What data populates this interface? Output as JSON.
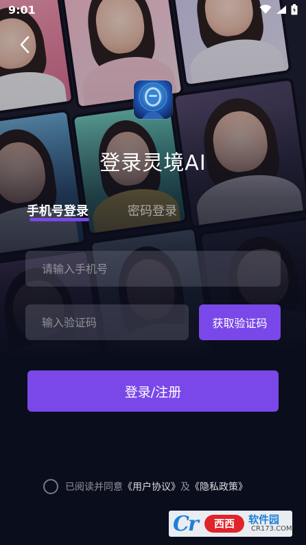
{
  "status_bar": {
    "time": "9:01",
    "icons": [
      "wifi-icon",
      "signal-icon",
      "battery-icon"
    ]
  },
  "navigation": {
    "back_icon": "chevron-left-icon"
  },
  "header": {
    "app_logo": "robot-avatar-logo",
    "title": "登录灵境AI"
  },
  "tabs": [
    {
      "label": "手机号登录",
      "active": true
    },
    {
      "label": "密码登录",
      "active": false
    }
  ],
  "form": {
    "phone_placeholder": "请输入手机号",
    "phone_value": "",
    "code_placeholder": "输入验证码",
    "code_value": "",
    "get_code_label": "获取验证码",
    "submit_label": "登录/注册"
  },
  "agreement": {
    "checked": false,
    "prefix": "已阅读并同意",
    "user_agreement": "《用户协议》",
    "conjunction": "及",
    "privacy_policy": "《隐私政策》"
  },
  "watermark": {
    "brand_mark": "Cr",
    "brand_badge": "西西",
    "name": "软件园",
    "domain": "CR173.COM"
  },
  "colors": {
    "accent": "#7a48e8",
    "background": "#0a0d1c",
    "input_fill": "rgba(120,120,140,0.32)"
  }
}
